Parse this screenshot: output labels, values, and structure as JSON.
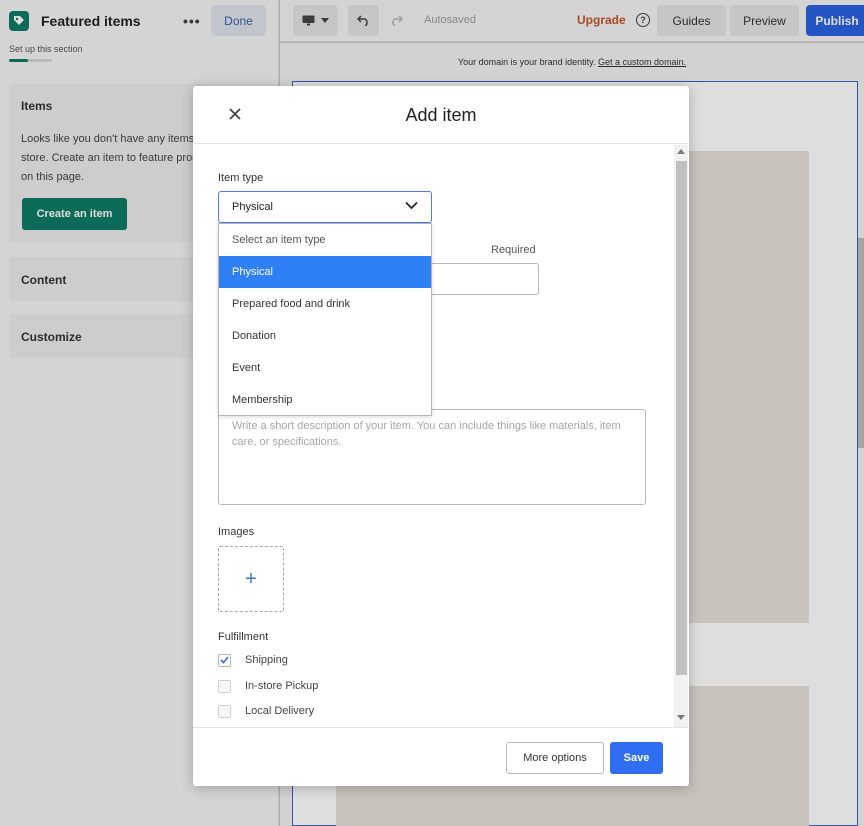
{
  "left_panel": {
    "title": "Featured items",
    "more_icon": "•••",
    "done_label": "Done",
    "subtitle": "Set up this section",
    "setup_progress": 0.45,
    "items_card": {
      "title": "Items",
      "text_line1": "Looks like you don't have any items in your",
      "text_line2": "store. Create an item to feature products",
      "text_line3": "on this page.",
      "create_label": "Create an item"
    },
    "content_label": "Content",
    "customize_label": "Customize"
  },
  "toolbar": {
    "autosaved": "Autosaved",
    "upgrade": "Upgrade",
    "help_icon": "?",
    "guides": "Guides",
    "preview": "Preview",
    "publish": "Publish"
  },
  "canvas": {
    "domain_text": "Your domain is your brand identity.",
    "domain_link": "Get a custom domain."
  },
  "modal": {
    "title": "Add item",
    "item_type_label": "Item type",
    "selected_type": "Physical",
    "required_label": "Required",
    "options": [
      "Select an item type",
      "Physical",
      "Prepared food and drink",
      "Donation",
      "Event",
      "Membership"
    ],
    "description_placeholder": "Write a short description of your item. You can include things like materials, item  care, or specifications.",
    "images_label": "Images",
    "add_image_symbol": "+",
    "fulfillment_label": "Fulfillment",
    "fulfillment": [
      {
        "label": "Shipping",
        "checked": true
      },
      {
        "label": "In-store Pickup",
        "checked": false
      },
      {
        "label": "Local Delivery",
        "checked": false
      }
    ],
    "more_options": "More options",
    "save": "Save"
  },
  "colors": {
    "brand_green": "#0e7a66",
    "primary_blue": "#2f6ef0",
    "selected_option": "#2f7ff5",
    "upgrade_orange": "#c0542b"
  }
}
